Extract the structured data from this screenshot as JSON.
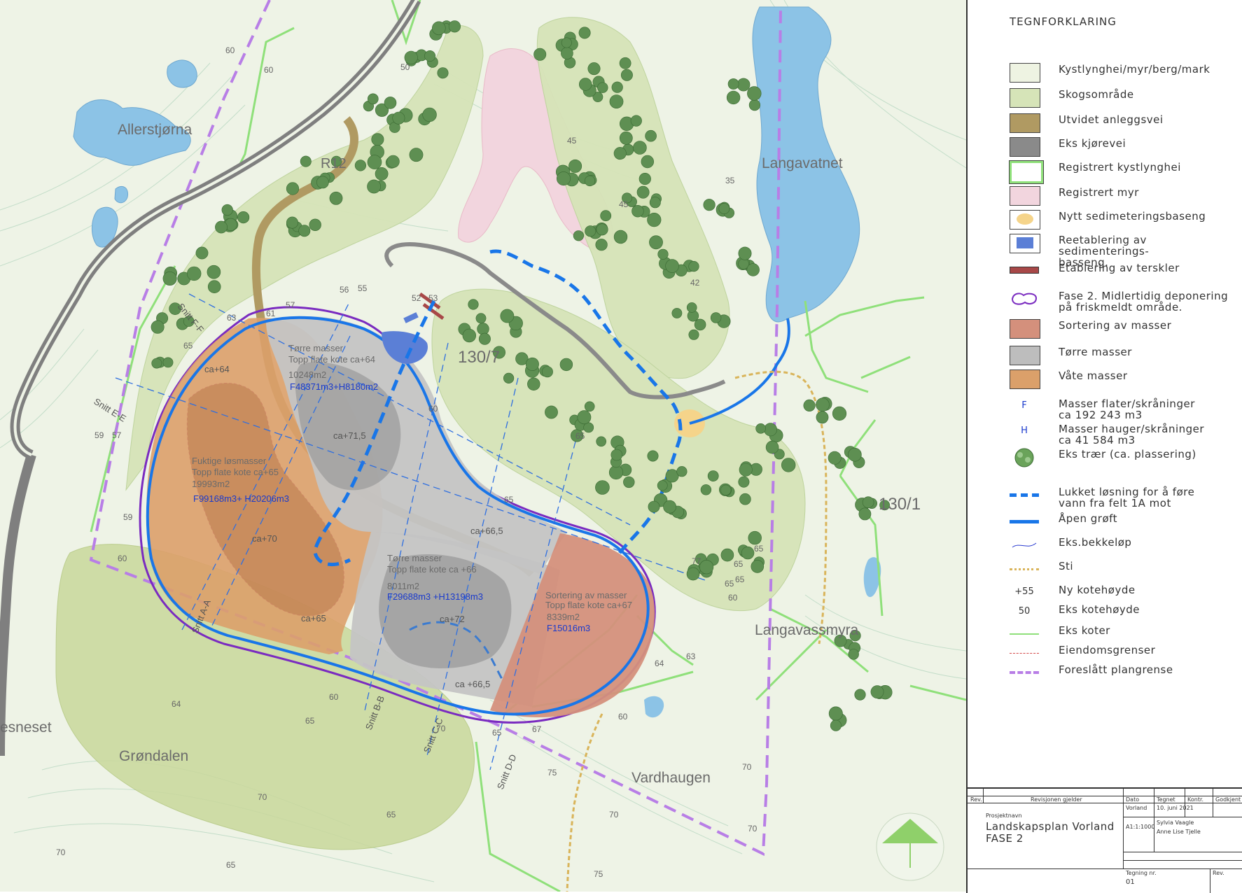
{
  "map": {
    "place_names": {
      "allerstjorna": "Allerstjørna",
      "langavatnet": "Langavatnet",
      "langavassmyra": "Langavassmyra",
      "grondalen": "Grøndalen",
      "vardhaugen": "Vardhaugen",
      "esneset": "esneset",
      "r12": "R12",
      "parcel_130_7": "130/7",
      "parcel_130_1": "130/1"
    },
    "zones": {
      "dry_north": {
        "title": "Tørre masser",
        "subtitle": "Topp flate kote ca+64",
        "area": "10248m2",
        "volume": "F48371m3+H8180m2"
      },
      "wet": {
        "title": "Fuktige løsmasser",
        "subtitle": "Topp flate kote ca+65",
        "area": "19993m2",
        "volume": "F99168m3+ H20206m3"
      },
      "dry_south": {
        "title": "Tørre masser",
        "subtitle": "Topp flate kote ca +66",
        "area": "8011m2",
        "volume": "F29688m3 +H13198m3"
      },
      "sorting": {
        "title": "Sortering av masser",
        "subtitle": "Topp flate kote ca+67",
        "area": "8339m2",
        "volume": "F15016m3"
      }
    },
    "elevations": {
      "ca64": "ca+64",
      "ca715": "ca+71,5",
      "ca70": "ca+70",
      "ca65": "ca+65",
      "ca665a": "ca+66,5",
      "ca72": "ca+72",
      "ca665b": "ca +66,5"
    },
    "sections": {
      "aa": "Snitt A-A",
      "bb": "Snitt B-B",
      "cc": "Snitt C-C",
      "dd": "Snitt D-D",
      "ee": "Snitt E-E",
      "ff": "Snitt F-F"
    },
    "contours": [
      "60",
      "60",
      "50",
      "45",
      "45",
      "42",
      "35",
      "53",
      "52",
      "55",
      "56",
      "57",
      "61",
      "63",
      "65",
      "60",
      "65",
      "59",
      "57",
      "59",
      "60",
      "64",
      "60",
      "65",
      "70",
      "70",
      "65",
      "70",
      "65",
      "65",
      "60",
      "65",
      "75",
      "70",
      "75",
      "70",
      "70",
      "65",
      "67",
      "65",
      "65",
      "64",
      "63",
      "60",
      "65",
      "77"
    ]
  },
  "legend": {
    "title": "TEGNFORKLARING",
    "items": [
      {
        "label": "Kystlynghei/myr/berg/mark",
        "color": "#eef3e2"
      },
      {
        "label": "Skogsområde",
        "color": "#d6e4b8"
      },
      {
        "label": "Utvidet anleggsvei",
        "color": "#b09a62"
      },
      {
        "label": "Eks kjørevei",
        "color": "#8a8a8a"
      },
      {
        "label": "Registrert kystlynghei",
        "color": "#8fe07a"
      },
      {
        "label": "Registrert myr",
        "color": "#f2d5de"
      },
      {
        "label": "Nytt sedimeteringsbaseng",
        "color": "#f5d48a"
      },
      {
        "label": "Reetablering av sedimenterings-\nbasseng.",
        "color": "#5b7fd6"
      },
      {
        "label": "Etablering av terskler",
        "color": "#a84848"
      },
      {
        "label": "Fase 2. Midlertidig deponering\npå friskmeldt område.",
        "color": "#7a2bc0"
      },
      {
        "label": "Sortering av masser",
        "color": "#d4907c"
      },
      {
        "label": "Tørre masser",
        "color": "#bdbdbd"
      },
      {
        "label": "Våte masser",
        "color": "#dba06a"
      },
      {
        "label": "Masser flater/skråninger\nca 192 243 m3",
        "symbol": "F",
        "color": "#1a3acc"
      },
      {
        "label": "Masser hauger/skråninger\nca 41 584 m3",
        "symbol": "H",
        "color": "#1a3acc"
      },
      {
        "label": "Eks trær  (ca. plassering)",
        "color": "#6aa35a"
      },
      {
        "label": "Lukket løsning for å føre\nvann fra felt 1A mot",
        "color": "#1976e8"
      },
      {
        "label": "Åpen grøft",
        "color": "#1976e8"
      },
      {
        "label": "Eks.bekkeløp",
        "color": "#2a3bd0"
      },
      {
        "label": "Sti",
        "color": "#d9b45a"
      },
      {
        "label": "Ny kotehøyde",
        "symbol": "+55"
      },
      {
        "label": "Eks kotehøyde",
        "symbol": "50"
      },
      {
        "label": "Eks koter",
        "color": "#8fe07a"
      },
      {
        "label": "Eiendomsgrenser",
        "color": "#d44a4a"
      },
      {
        "label": "Foreslått plangrense",
        "color": "#b87ee6"
      }
    ]
  },
  "title_block": {
    "rev_label": "Rev.",
    "revision_label": "Revisjonen gjelder",
    "date_label": "Dato",
    "drawn_label": "Tegnet",
    "checked_label": "Kontr.",
    "approved_label": "Godkjent",
    "project_label": "Prosjektnavn",
    "project_name": "Landskapsplan Vorland",
    "phase": "FASE 2",
    "scale": "A1:1:1000",
    "date_value": "10. juni 2021",
    "drawn_by": "Sylvia Vaagle",
    "checked_by": "Anne Lise Tjelle",
    "client": "Vorland",
    "drawing_no_label": "Tegning nr.",
    "drawing_no": "01",
    "rev2_label": "Rev."
  }
}
